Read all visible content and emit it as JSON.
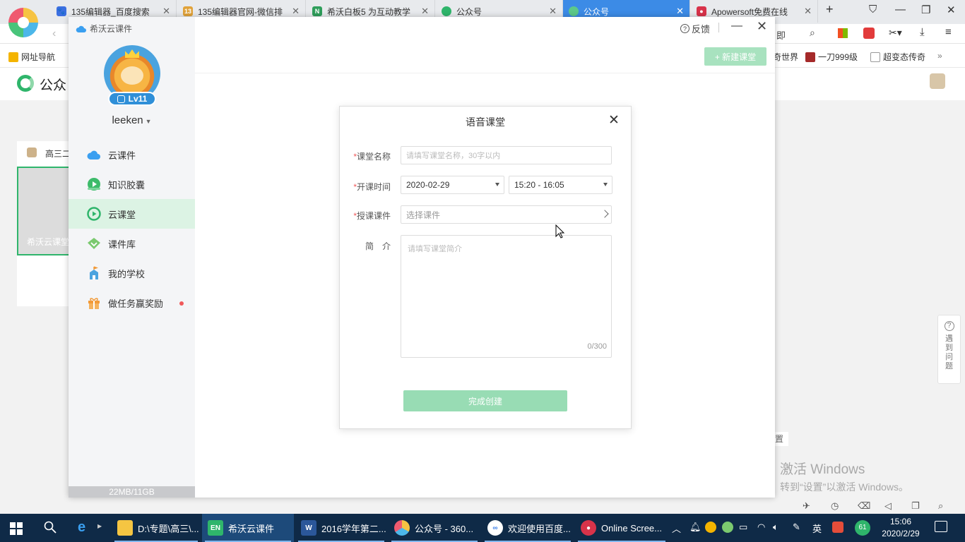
{
  "browser": {
    "tabs": [
      {
        "label": "135编辑器_百度搜索",
        "icon": "paw-icon"
      },
      {
        "label": "135编辑器官网-微信排",
        "icon": "135-icon"
      },
      {
        "label": "希沃白板5 为互动教学",
        "icon": "n-icon"
      },
      {
        "label": "公众号",
        "icon": "wechat-icon"
      },
      {
        "label": "公众号",
        "icon": "wechat-icon",
        "active": true
      },
      {
        "label": "Apowersoft免费在线",
        "icon": "camera-icon"
      }
    ],
    "new_tab": "+",
    "bookmarks": [
      {
        "label": "网址导航"
      },
      {
        "label": "奇世界"
      },
      {
        "label": "一刀999级"
      },
      {
        "label": "超变态传奇"
      }
    ],
    "bookmarks_more": "»",
    "addr_fragment": "即"
  },
  "background_page": {
    "logo_text": "公众",
    "card_title": "高三二",
    "card_caption": "希沃云课堂",
    "help_text": [
      "遇",
      "到",
      "问",
      "题"
    ],
    "help_icon": "?",
    "bottom_fragment": "置"
  },
  "activation": {
    "line1": "激活 Windows",
    "line2": "转到“设置”以激活 Windows。"
  },
  "app": {
    "title": "希沃云课件",
    "level": "Lv11",
    "username": "leeken",
    "feedback": "反馈",
    "new_class": "+ 新建课堂",
    "storage": "22MB/11GB",
    "nav": [
      {
        "label": "云课件",
        "icon": "cloud-icon",
        "color": "#3a9ff0"
      },
      {
        "label": "知识胶囊",
        "icon": "capsule-icon",
        "color": "#3dbb6a"
      },
      {
        "label": "云课堂",
        "icon": "play-circle-icon",
        "color": "#2fb56b",
        "active": true
      },
      {
        "label": "课件库",
        "icon": "library-icon",
        "color": "#7bc96f"
      },
      {
        "label": "我的学校",
        "icon": "school-icon",
        "color": "#4aa3df"
      },
      {
        "label": "做任务赢奖励",
        "icon": "gift-icon",
        "color": "#f29a38",
        "dot": true
      }
    ]
  },
  "dialog": {
    "title": "语音课堂",
    "name_label": "课堂名称",
    "name_placeholder": "请填写课堂名称，30字以内",
    "time_label": "开课时间",
    "date_value": "2020-02-29",
    "time_value": "15:20 - 16:05",
    "courseware_label": "授课课件",
    "courseware_placeholder": "选择课件",
    "intro_label": "简　介",
    "intro_placeholder": "请填写课堂简介",
    "intro_count": "0/300",
    "submit": "完成创建",
    "required_mark": "*"
  },
  "taskbar": {
    "items": [
      {
        "label": "D:\\专题\\高三\\...",
        "icon": "folder-icon"
      },
      {
        "label": "希沃云课件",
        "icon": "easinote-icon",
        "active": true
      },
      {
        "label": "2016学年第二...",
        "icon": "word-icon"
      },
      {
        "label": "公众号 - 360...",
        "icon": "browser360-icon"
      },
      {
        "label": "欢迎使用百度...",
        "icon": "baidu-netdisk-icon"
      },
      {
        "label": "Online Scree...",
        "icon": "screen-recorder-icon"
      }
    ],
    "tray_ime": "英",
    "tray_badge": "61",
    "time": "15:06",
    "date": "2020/2/29"
  }
}
